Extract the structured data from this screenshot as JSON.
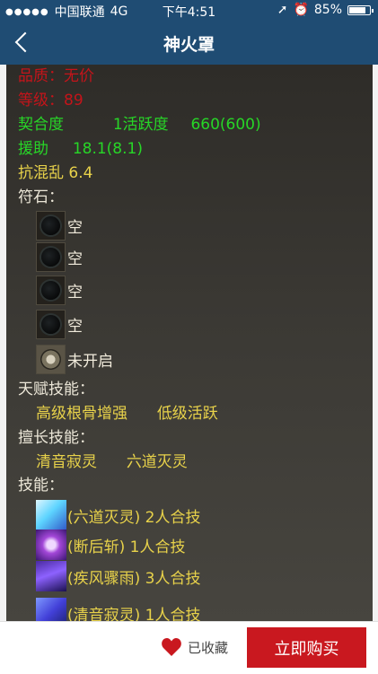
{
  "status_bar": {
    "carrier": "中国联通",
    "network": "4G",
    "time": "下午4:51",
    "battery": "85%",
    "battery_level": 0.85
  },
  "nav": {
    "title": "神火罩"
  },
  "item": {
    "quality": "品质：无价",
    "level": "等级：89",
    "fit_label": "契合度",
    "fit_value": "1活跃度",
    "fit_stat": "660(600)",
    "assist_label": "援助",
    "assist_value": "18.1(8.1)",
    "anti_chaos": "抗混乱 6.4",
    "runes_label": "符石：",
    "runes": [
      {
        "text": "空",
        "icon": "empty-rune-icon"
      },
      {
        "text": "空",
        "icon": "empty-rune-icon"
      },
      {
        "text": "空",
        "icon": "empty-rune-icon"
      },
      {
        "text": "空",
        "icon": "empty-rune-icon"
      },
      {
        "text": "未开启",
        "icon": "locked-rune-icon"
      }
    ],
    "talent_label": "天赋技能：",
    "talent_skills": [
      "高级根骨增强",
      "低级活跃"
    ],
    "specialty_label": "擅长技能：",
    "specialty_skills": [
      "清音寂灵",
      "六道灭灵"
    ],
    "skills_label": "技能：",
    "skills": [
      {
        "text": "(六道灭灵) 2人合技",
        "icon": "skill-icon-1"
      },
      {
        "text": "(断后斩) 1人合技",
        "icon": "skill-icon-2"
      },
      {
        "text": "(疾风骤雨) 3人合技",
        "icon": "skill-icon-3"
      },
      {
        "text": "(清音寂灵) 1人合技",
        "icon": "skill-icon-4"
      }
    ]
  },
  "bottom_bar": {
    "collect_label": "已收藏",
    "buy_label": "立即购买"
  },
  "colors": {
    "nav_bg": "#1f4c73",
    "buy_bg": "#c9181f",
    "red_text": "#c4141a",
    "green_text": "#27d627",
    "yellow_text": "#e8d24a"
  }
}
